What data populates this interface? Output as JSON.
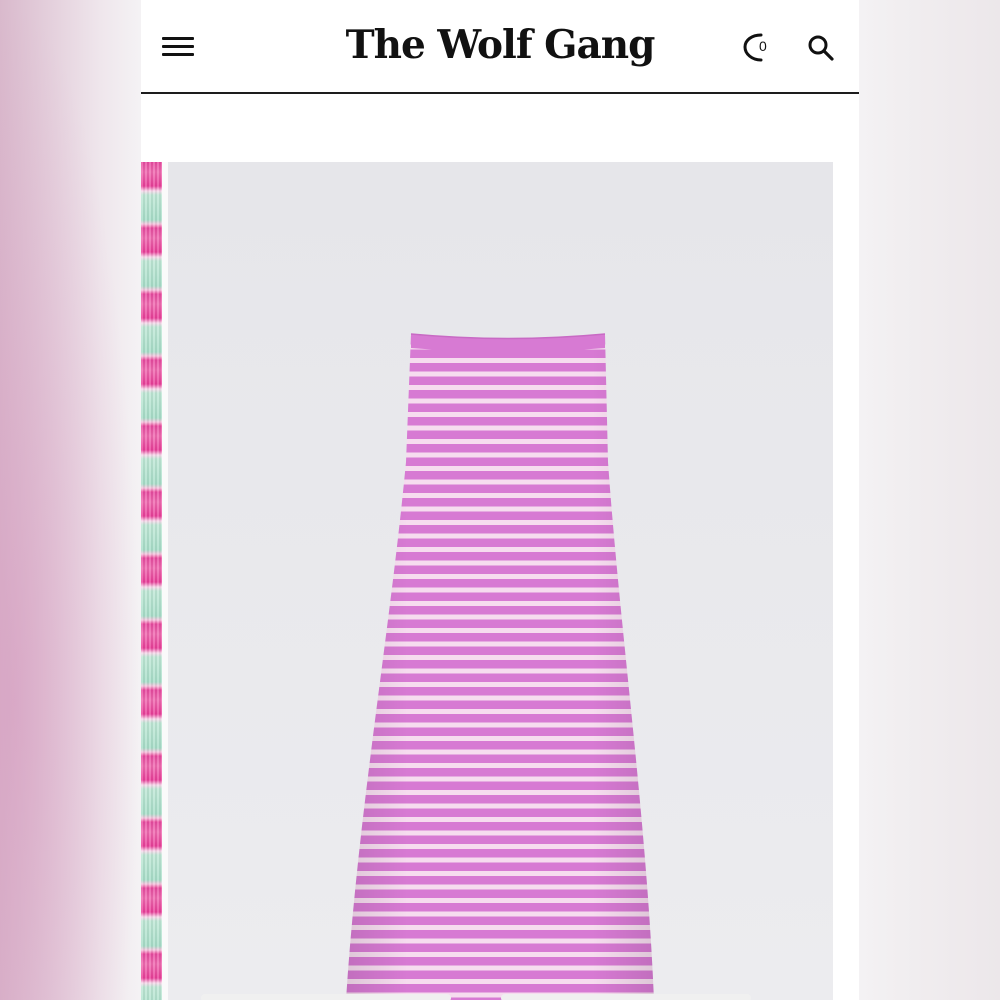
{
  "header": {
    "brand": "The Wolf Gang",
    "bag_count": "0"
  },
  "icons": {
    "menu": "hamburger-menu-icon",
    "bag": "shopping-bag-icon",
    "search": "search-icon"
  },
  "colors": {
    "header_border": "#1d1d1d",
    "product_background": "#e9e9ec",
    "dress_pink": "#d77ad3",
    "dress_stripe": "#f6dcef",
    "thumbnail_pink": "#ec4c9e",
    "thumbnail_mint": "#bfe8d6"
  },
  "product": {
    "image": "pink-and-white-striped-strapless-knit-maxi-dress"
  }
}
